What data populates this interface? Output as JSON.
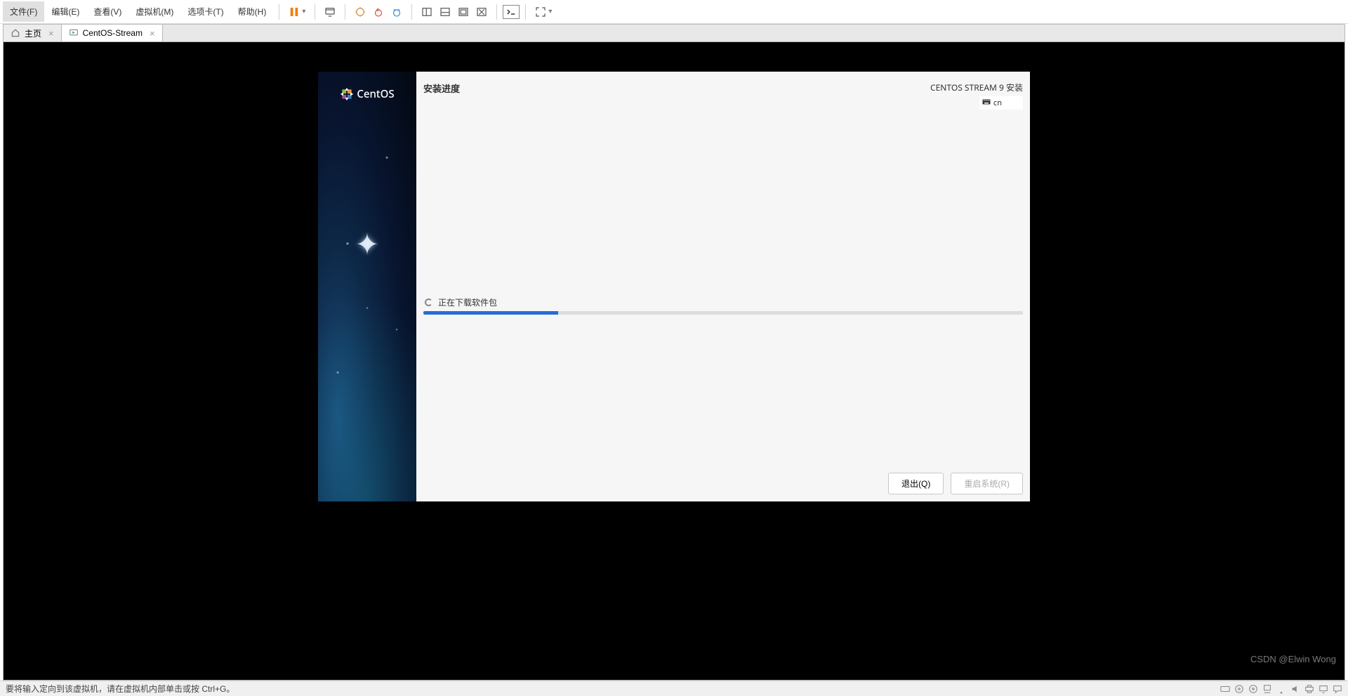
{
  "menubar": {
    "file": "文件(F)",
    "edit": "编辑(E)",
    "view": "查看(V)",
    "vm": "虚拟机(M)",
    "tabs": "选项卡(T)",
    "help": "帮助(H)"
  },
  "tabs": {
    "home": "主页",
    "vm_name": "CentOS-Stream"
  },
  "anaconda": {
    "brand": "CentOS",
    "title": "安装进度",
    "subtitle": "CENTOS STREAM 9 安装",
    "keyboard": "cn",
    "progress_label": "正在下载软件包",
    "progress_percent": 22.5,
    "quit_btn": "退出(Q)",
    "reboot_btn": "重启系统(R)"
  },
  "statusbar": {
    "hint": "要将输入定向到该虚拟机，请在虚拟机内部单击或按 Ctrl+G。"
  },
  "watermark": "CSDN @Elwin Wong"
}
